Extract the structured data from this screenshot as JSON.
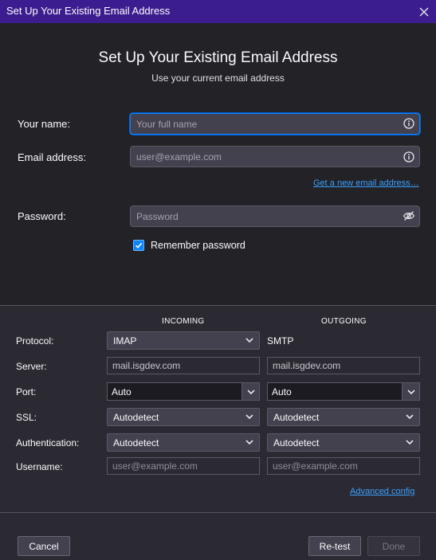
{
  "window": {
    "title": "Set Up Your Existing Email Address"
  },
  "header": {
    "title": "Set Up Your Existing Email Address",
    "subtitle": "Use your current email address"
  },
  "form": {
    "name_label": "Your name:",
    "name_placeholder": "Your full name",
    "email_label": "Email address:",
    "email_placeholder": "user@example.com",
    "new_email_link": "Get a new email address…",
    "password_label": "Password:",
    "password_placeholder": "Password",
    "remember_label": "Remember password",
    "remember_checked": true
  },
  "server_settings": {
    "incoming_header": "INCOMING",
    "outgoing_header": "OUTGOING",
    "rows": {
      "protocol_label": "Protocol:",
      "server_label": "Server:",
      "port_label": "Port:",
      "ssl_label": "SSL:",
      "auth_label": "Authentication:",
      "username_label": "Username:"
    },
    "incoming": {
      "protocol": "IMAP",
      "server": "mail.isgdev.com",
      "port": "Auto",
      "ssl": "Autodetect",
      "auth": "Autodetect",
      "username_placeholder": "user@example.com"
    },
    "outgoing": {
      "protocol": "SMTP",
      "server": "mail.isgdev.com",
      "port": "Auto",
      "ssl": "Autodetect",
      "auth": "Autodetect",
      "username_placeholder": "user@example.com"
    },
    "advanced_link": "Advanced config"
  },
  "footer": {
    "cancel": "Cancel",
    "retest": "Re-test",
    "done": "Done"
  },
  "colors": {
    "titlebar": "#3b1d8f",
    "accent": "#0a84ff",
    "background": "#2b2a33"
  },
  "icons": {
    "info": "info-icon",
    "eye_off": "eye-off-icon",
    "check": "checkmark-icon",
    "close": "close-icon",
    "chevron": "chevron-down-icon"
  }
}
